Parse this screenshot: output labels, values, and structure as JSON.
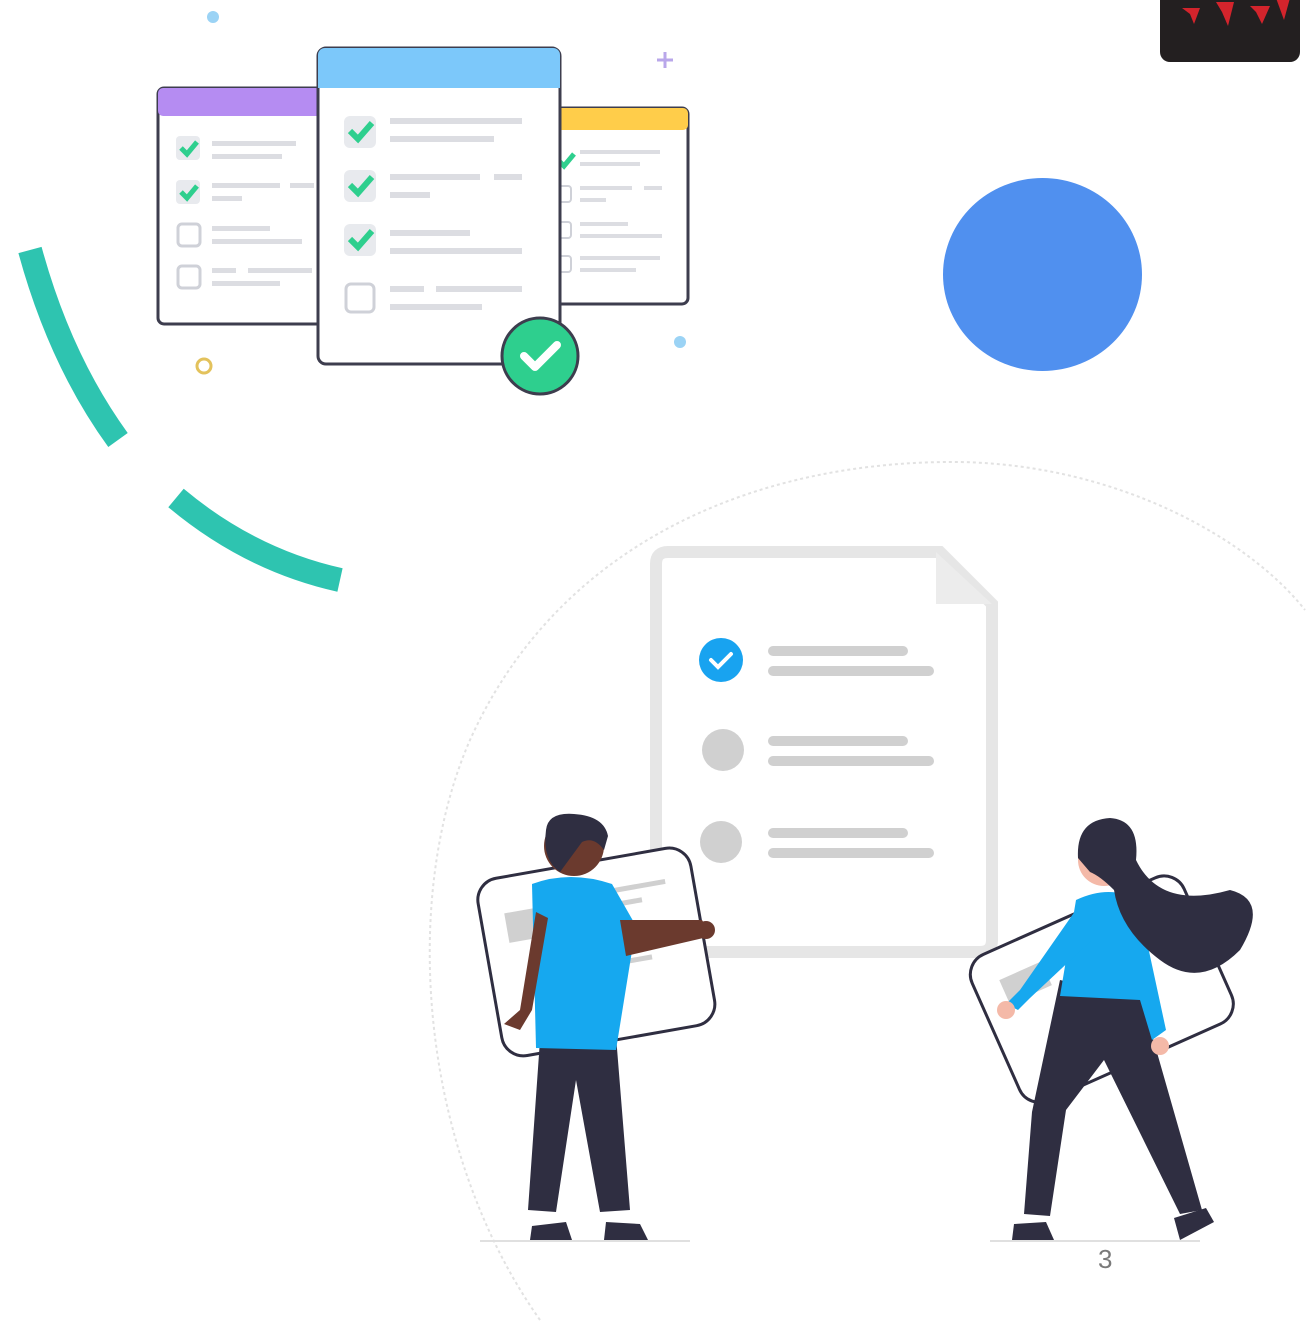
{
  "slide": {
    "page_number": "3"
  },
  "colors": {
    "teal_arc": "#2ec4b0",
    "blue_circle": "#5090ef",
    "logo_bg": "#231f20",
    "logo_red": "#d3242c",
    "purple_header": "#b58cf2",
    "blue_header": "#7cc8fa",
    "yellow_header": "#ffcd4a",
    "check_green": "#2ecf8e",
    "shirt_blue": "#16a8ef",
    "dark": "#2f2e41",
    "skin_dark": "#6b3a2e",
    "skin_light": "#f4b9a8",
    "checked_blue": "#18a3f0",
    "unchecked_gray": "#d0d0d0"
  },
  "icons": {
    "logo": "brand-logo-icon",
    "checklist_illustration": "checklist-cards-icon",
    "people_illustration": "people-with-checklist-icon"
  }
}
